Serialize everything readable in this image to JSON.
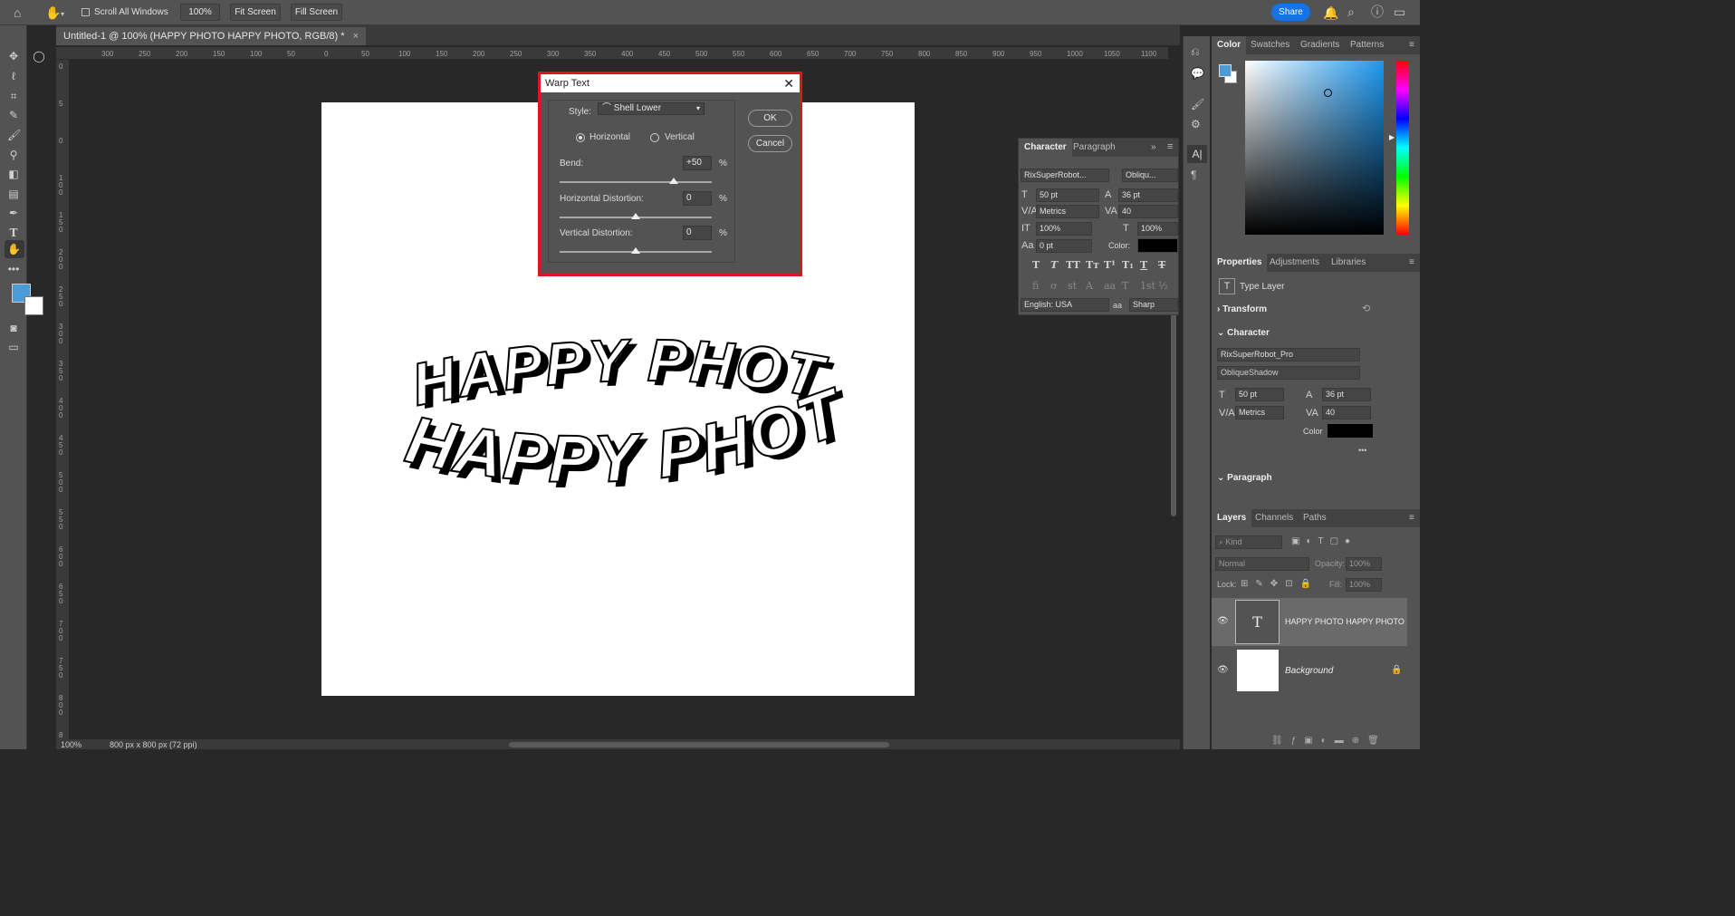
{
  "options_bar": {
    "scroll_all_windows": "Scroll All Windows",
    "zoom": "100%",
    "fit_screen": "Fit Screen",
    "fill_screen": "Fill Screen",
    "share": "Share"
  },
  "document": {
    "tab_title": "Untitled-1 @ 100% (HAPPY PHOTO HAPPY PHOTO, RGB/8) *",
    "close": "×",
    "canvas_text_line1": "HAPPY PHOTO",
    "canvas_text_line2": "HAPPY PHOTO"
  },
  "rulers": {
    "h_ticks": [
      "300",
      "250",
      "200",
      "150",
      "100",
      "50",
      "0",
      "50",
      "100",
      "150",
      "200",
      "250",
      "300",
      "350",
      "400",
      "450",
      "500",
      "550",
      "600",
      "650",
      "700",
      "750",
      "800",
      "850",
      "900",
      "950",
      "1000",
      "1050",
      "1100"
    ],
    "v_ticks": [
      "0",
      "5",
      "0",
      "1 0 0",
      "1 5 0",
      "2 0 0",
      "2 5 0",
      "3 0 0",
      "3 5 0",
      "4 0 0",
      "4 5 0",
      "5 0 0",
      "5 5 0",
      "6 0 0",
      "6 5 0",
      "7 0 0",
      "7 5 0",
      "8 0 0",
      "8"
    ]
  },
  "status_bar": {
    "zoom": "100%",
    "doc_size": "800 px x 800 px (72 ppi)"
  },
  "warp_dialog": {
    "title": "Warp Text",
    "style_label": "Style:",
    "style_value": "Shell Lower",
    "horizontal": "Horizontal",
    "vertical": "Vertical",
    "orientation_selected": "horizontal",
    "bend_label": "Bend:",
    "bend_value": "+50",
    "bend_level": 75,
    "hdist_label": "Horizontal Distortion:",
    "hdist_value": "0",
    "hdist_level": 50,
    "vdist_label": "Vertical Distortion:",
    "vdist_value": "0",
    "vdist_level": 50,
    "pct": "%",
    "ok": "OK",
    "cancel": "Cancel"
  },
  "character_panel": {
    "tab_character": "Character",
    "tab_paragraph": "Paragraph",
    "font_family": "RixSuperRobot...",
    "font_style": "Obliqu...",
    "size": "50 pt",
    "leading": "36 pt",
    "kerning": "Metrics",
    "tracking": "40",
    "vscale": "100%",
    "hscale": "100%",
    "baseline": "0 pt",
    "color_label": "Color:",
    "color": "#000000",
    "language": "English: USA",
    "aa_label": "a",
    "antialias": "Sharp"
  },
  "color_panel": {
    "tabs": [
      "Color",
      "Swatches",
      "Gradients",
      "Patterns"
    ],
    "fg": "#4b9bd6",
    "bg": "#ffffff"
  },
  "properties_panel": {
    "tabs": [
      "Properties",
      "Adjustments",
      "Libraries"
    ],
    "layer_type": "Type Layer",
    "transform": "Transform",
    "character": "Character",
    "font_family": "RixSuperRobot_Pro",
    "font_style": "ObliqueShadow",
    "size": "50 pt",
    "leading": "36 pt",
    "kerning": "Metrics",
    "tracking": "40",
    "color_label": "Color",
    "more": "•••",
    "paragraph": "Paragraph"
  },
  "layers_panel": {
    "tabs": [
      "Layers",
      "Channels",
      "Paths"
    ],
    "kind": "Kind",
    "blend": "Normal",
    "opacity_label": "Opacity:",
    "opacity": "100%",
    "lock_label": "Lock:",
    "fill_label": "Fill:",
    "fill": "100%",
    "layers": [
      {
        "name": "HAPPY PHOTO HAPPY PHOTO",
        "thumb": "T"
      },
      {
        "name": "Background",
        "thumb": ""
      }
    ]
  }
}
